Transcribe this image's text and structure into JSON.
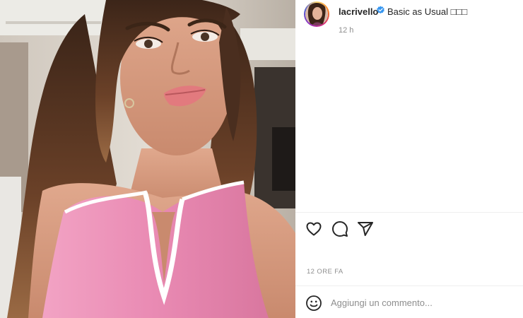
{
  "post": {
    "username": "lacrivello",
    "verified": true,
    "caption": "Basic as Usual □□□",
    "relative_time": "12 h",
    "timestamp": "12 ORE FA",
    "comment_placeholder": "Aggiungi un commento..."
  },
  "icons": {
    "like": "heart-icon",
    "comment": "comment-icon",
    "share": "share-icon",
    "emoji": "emoji-icon",
    "verified": "verified-badge-icon"
  },
  "colors": {
    "verified_blue": "#3897f0",
    "text_primary": "#262626",
    "text_secondary": "#8e8e8e",
    "divider": "#efefef"
  }
}
